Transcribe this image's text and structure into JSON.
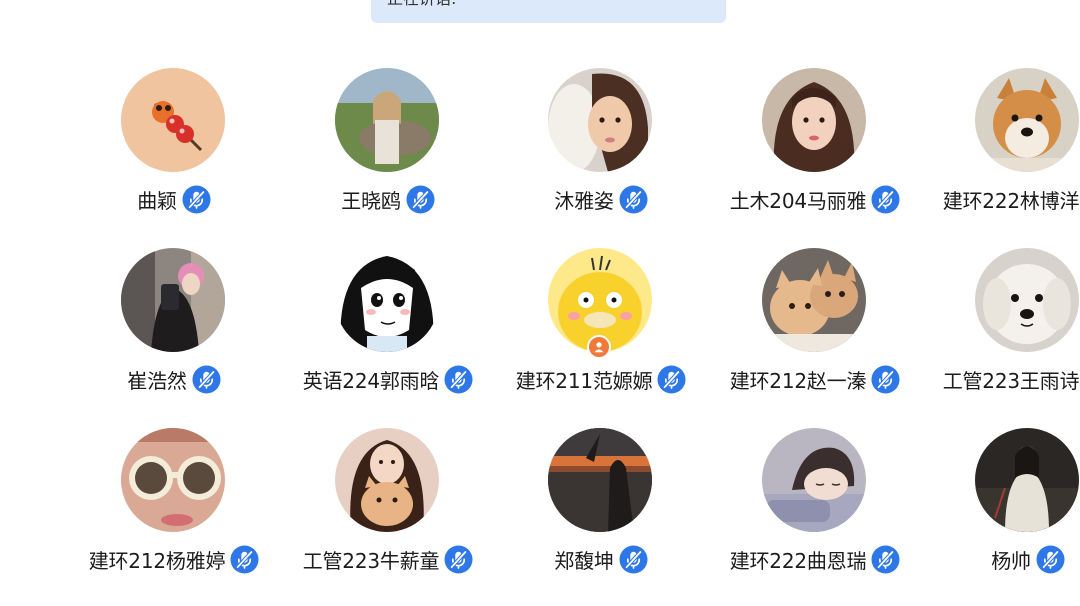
{
  "banner": {
    "text": "正在讲话:"
  },
  "participants": [
    {
      "name": "曲颖",
      "avatar": "tanghulu-avatar",
      "mic": "mic-muted-icon"
    },
    {
      "name": "王晓鸥",
      "avatar": "grassland-photo-avatar",
      "mic": "mic-muted-icon"
    },
    {
      "name": "沐雅姿",
      "avatar": "child-photo-avatar",
      "mic": "mic-muted-icon"
    },
    {
      "name": "土木204马丽雅",
      "avatar": "portrait-photo-avatar",
      "mic": "mic-muted-icon"
    },
    {
      "name": "建环222林博洋",
      "avatar": "dog-photo-avatar",
      "mic": "mic-muted-icon"
    },
    {
      "name": "崔浩然",
      "avatar": "mirror-selfie-avatar",
      "mic": "mic-muted-icon"
    },
    {
      "name": "英语224郭雨晗",
      "avatar": "manga-girl-avatar",
      "mic": "mic-muted-icon"
    },
    {
      "name": "建环211范嫄嫄",
      "avatar": "psyduck-avatar",
      "mic": "mic-muted-icon",
      "host": true
    },
    {
      "name": "建环212赵一溱",
      "avatar": "kittens-photo-avatar",
      "mic": "mic-muted-icon"
    },
    {
      "name": "工管223王雨诗",
      "avatar": "white-dog-avatar",
      "mic": "mic-muted-icon"
    },
    {
      "name": "建环212杨雅婷",
      "avatar": "sunglasses-photo-avatar",
      "mic": "mic-muted-icon"
    },
    {
      "name": "工管223牛薪童",
      "avatar": "girl-with-cat-avatar",
      "mic": "mic-muted-icon"
    },
    {
      "name": "郑馥坤",
      "avatar": "sunset-photo-avatar",
      "mic": "mic-muted-icon"
    },
    {
      "name": "建环222曲恩瑞",
      "avatar": "anime-boy-avatar",
      "mic": "mic-muted-icon"
    },
    {
      "name": "杨帅",
      "avatar": "ancient-costume-avatar",
      "mic": "mic-muted-icon"
    }
  ],
  "colors": {
    "mic_blue": "#2d77e6",
    "host_badge": "#ef7b3a",
    "banner_bg": "#dce9fb"
  }
}
